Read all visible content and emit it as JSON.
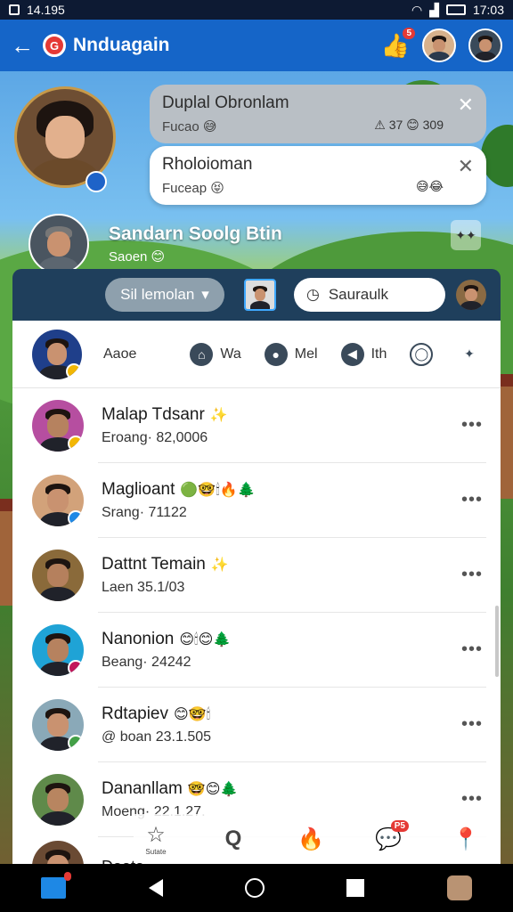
{
  "status": {
    "time_left": "14.195",
    "battery": "17:03"
  },
  "appbar": {
    "title": "Nnduagain",
    "logo_letter": "G",
    "like_badge": "5"
  },
  "notifications": [
    {
      "title": "Duplal Obronlam",
      "sub": "Fucao",
      "sub_emoji": "😅",
      "meta": "⚠ 37 😊 309"
    },
    {
      "title": "Rholoioman",
      "sub": "Fuceap",
      "sub_emoji": "😝",
      "meta": "😅😂"
    }
  ],
  "game": {
    "name": "Sandarn Soolg Btin",
    "sub": "Saoen 😊"
  },
  "filter": {
    "dropdown_label": "Sil lemolan",
    "search_text": "Sauraulk"
  },
  "quickbar": {
    "label": "Aaoe",
    "actions": [
      {
        "icon": "home-icon",
        "glyph": "⌂",
        "label": "Wa"
      },
      {
        "icon": "pin-icon",
        "glyph": "●",
        "label": "Mel"
      },
      {
        "icon": "volume-icon",
        "glyph": "◀",
        "label": "Ith"
      },
      {
        "icon": "chat-icon",
        "glyph": "◯",
        "label": ""
      },
      {
        "icon": "sparkle-icon",
        "glyph": "✦",
        "label": ""
      }
    ]
  },
  "contacts": [
    {
      "name": "Malap Tdsanr",
      "emoji": "✨",
      "sub": "Eroang·  82,0006",
      "skin": "#b6825f",
      "bg": "#b64ea0",
      "badge": "#f2b705"
    },
    {
      "name": "Maglioant",
      "emoji": "🟢🤓🕯🔥🌲",
      "sub": "Srang·  71122",
      "skin": "#c99270",
      "bg": "#d2a27a",
      "badge": "#1e88e5"
    },
    {
      "name": "Dattnt Temain",
      "emoji": "✨",
      "sub": "Laen  35.1/03",
      "skin": "#b5805d",
      "bg": "#8a6a3a",
      "badge": ""
    },
    {
      "name": "Nanonion",
      "emoji": "😊🕯😊🌲",
      "sub": "Beang·  24242",
      "skin": "#b6825f",
      "bg": "#1fa3d6",
      "badge": "#c2185b"
    },
    {
      "name": "Rdtapiev",
      "emoji": "😊🤓🕯",
      "sub": "@ boan  23.1.505",
      "skin": "#c99270",
      "bg": "#8aa9b8",
      "badge": "#43a047"
    },
    {
      "name": "Dananllam",
      "emoji": "🤓😊🌲",
      "sub": "Moeng·  22.1.27.",
      "skin": "#b88560",
      "bg": "#5f8a4a",
      "badge": ""
    }
  ],
  "peek_name": "Daata",
  "tabs": [
    {
      "icon": "star-icon",
      "glyph": "☆",
      "label": "Sutate"
    },
    {
      "icon": "search-icon",
      "glyph": "Q",
      "label": ""
    },
    {
      "icon": "fire-icon",
      "glyph": "🔥",
      "label": ""
    },
    {
      "icon": "message-icon",
      "glyph": "💬",
      "label": "",
      "badge": "P5"
    },
    {
      "icon": "location-icon",
      "glyph": "📍",
      "label": ""
    }
  ],
  "colors": {
    "appbar": "#1565c8",
    "filterbar": "#1f3f5c",
    "accent_red": "#e53935"
  }
}
